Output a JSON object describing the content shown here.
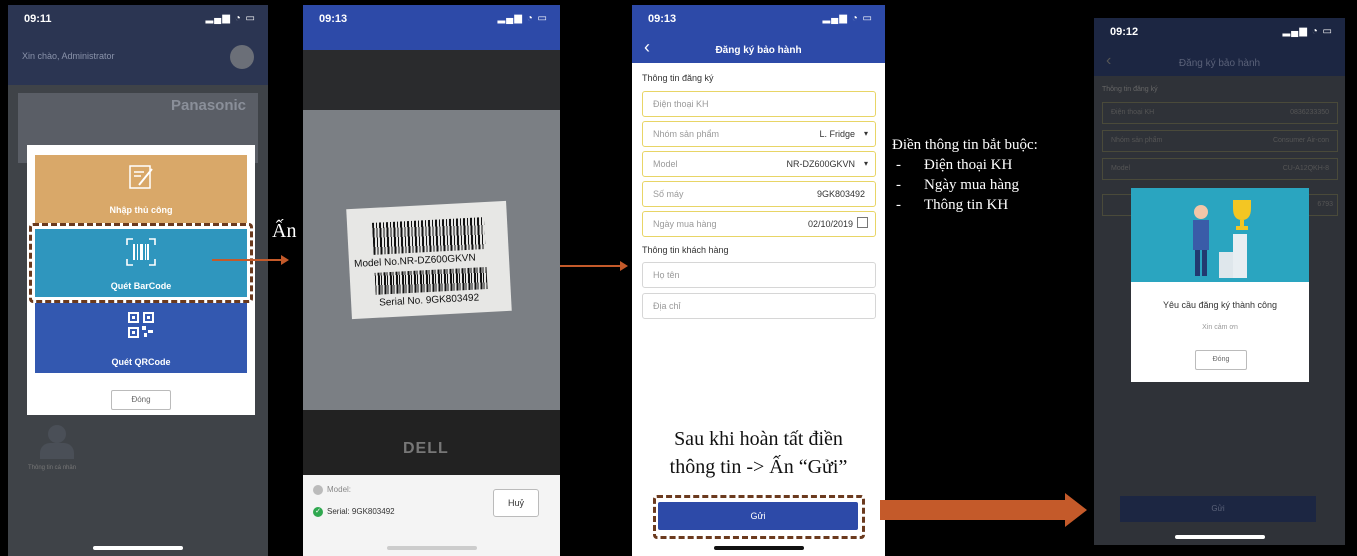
{
  "screen1": {
    "time": "09:11",
    "greeting": "Xin chào, Administrator",
    "brand": "Panasonic",
    "profile_label": "Thông tin cá nhân",
    "modal": {
      "manual_label": "Nhập thủ công",
      "barcode_label": "Quét BarCode",
      "qrcode_label": "Quét QRCode",
      "close_label": "Đóng"
    }
  },
  "annotation_an": "Ấn",
  "screen2": {
    "time": "09:13",
    "barcode_model": "Model No.NR-DZ600GKVN",
    "barcode_serial": "Serial No. 9GK803492",
    "laptop_brand": "DELL",
    "model_label": "Model:",
    "serial_label": "Serial: 9GK803492",
    "cancel_label": "Huỷ"
  },
  "screen3": {
    "time": "09:13",
    "title": "Đăng ký bảo hành",
    "section_reg": "Thông tin đăng ký",
    "fields": [
      {
        "placeholder": "Điện thoại KH",
        "value": ""
      },
      {
        "placeholder": "Nhóm sản phẩm",
        "value": "L. Fridge"
      },
      {
        "placeholder": "Model",
        "value": "NR-DZ600GKVN"
      },
      {
        "placeholder": "Số máy",
        "value": "9GK803492"
      },
      {
        "placeholder": "Ngày mua hàng",
        "value": "02/10/2019"
      }
    ],
    "section_cust": "Thông tin khách hàng",
    "cust_fields": [
      {
        "placeholder": "Họ tên"
      },
      {
        "placeholder": "Địa chỉ"
      }
    ],
    "submit_label": "Gửi"
  },
  "note_required": {
    "heading": "Điền thông tin bắt buộc:",
    "items": [
      "Điện thoại KH",
      "Ngày mua hàng",
      "Thông tin KH"
    ]
  },
  "note_after": {
    "line1": "Sau khi hoàn tất điền",
    "line2": "thông tin -> Ấn “Gửi”"
  },
  "screen4": {
    "time": "09:12",
    "title": "Đăng ký bảo hành",
    "section_reg": "Thông tin đăng ký",
    "phone_label": "Điện thoại KH",
    "phone_value": "0836233350",
    "group_label": "Nhóm sản phẩm",
    "group_value": "Consumer Air-con",
    "model_label": "Model",
    "model_value": "CU-A12QKH-8",
    "serial_value_tail": "6793",
    "success_title": "Yêu cầu đăng ký thành công",
    "success_sub": "Xin cảm ơn",
    "close_label": "Đóng",
    "submit_label": "Gửi"
  },
  "colors": {
    "navy": "#2d4aa8",
    "manual_orange": "#d9a869",
    "barcode_teal": "#2f96be",
    "arrow": "#c45a2a",
    "dash_brown": "#6b3a1e",
    "field_border": "#e8d566"
  }
}
